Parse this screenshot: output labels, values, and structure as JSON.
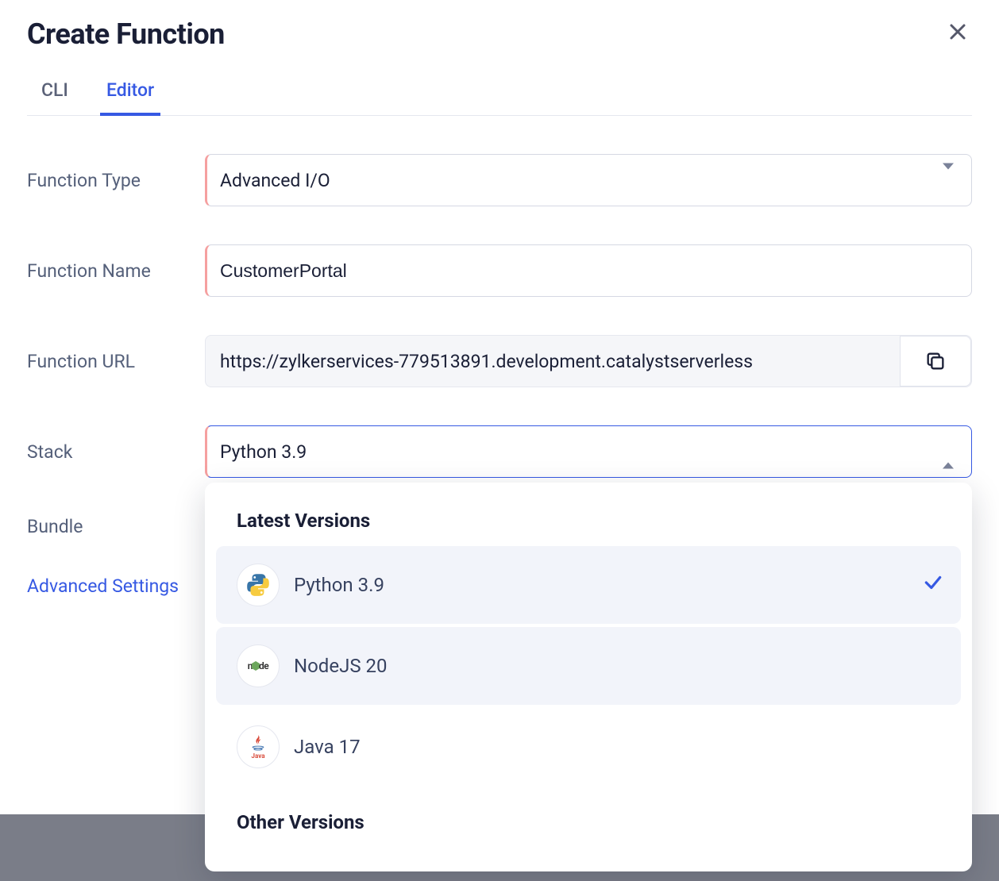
{
  "title": "Create Function",
  "tabs": {
    "cli": "CLI",
    "editor": "Editor"
  },
  "labels": {
    "functionType": "Function Type",
    "functionName": "Function Name",
    "functionURL": "Function URL",
    "stack": "Stack",
    "bundle": "Bundle",
    "advanced": "Advanced Settings"
  },
  "values": {
    "functionType": "Advanced I/O",
    "functionName": "CustomerPortal",
    "functionURL": "https://zylkerservices-779513891.development.catalystserverless",
    "stack": "Python 3.9"
  },
  "dropdown": {
    "latestHeader": "Latest Versions",
    "otherHeader": "Other Versions",
    "options": {
      "python": "Python 3.9",
      "node": "NodeJS 20",
      "java": "Java 17"
    }
  }
}
